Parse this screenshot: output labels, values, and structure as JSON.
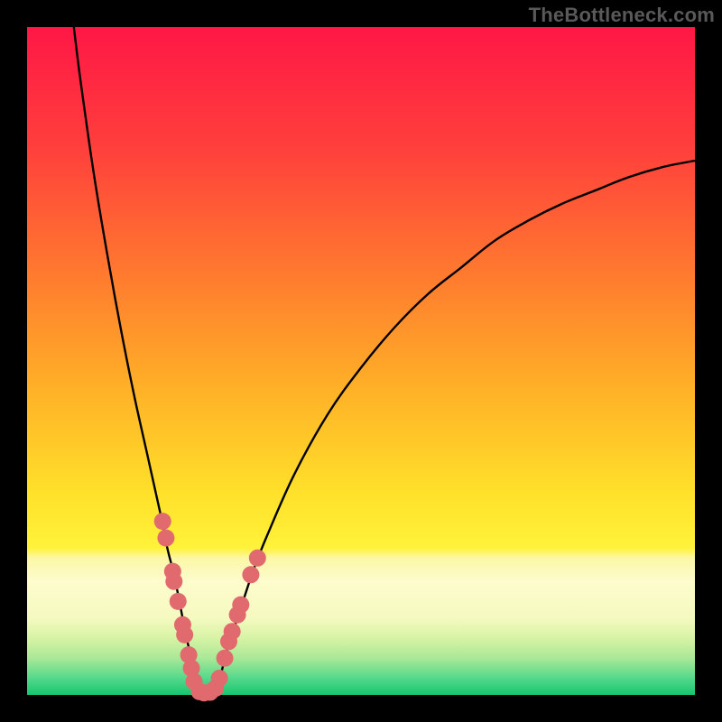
{
  "site": {
    "watermark": "TheBottleneck.com"
  },
  "chart_data": {
    "type": "line",
    "title": "",
    "xlabel": "",
    "ylabel": "",
    "xlim": [
      0,
      100
    ],
    "ylim": [
      0,
      100
    ],
    "series": [
      {
        "name": "left-curve",
        "x": [
          7,
          8,
          10,
          12,
          14,
          16,
          18,
          20,
          21,
          22,
          23,
          24,
          25,
          25.5,
          26
        ],
        "y": [
          100,
          92,
          78,
          66,
          55,
          45,
          36,
          27,
          22,
          18,
          13,
          8,
          4,
          1.5,
          0
        ]
      },
      {
        "name": "right-curve",
        "x": [
          28,
          29,
          30,
          32,
          34,
          36,
          40,
          45,
          50,
          55,
          60,
          65,
          70,
          75,
          80,
          85,
          90,
          95,
          100
        ],
        "y": [
          0,
          3,
          7,
          13,
          19,
          24,
          33,
          42,
          49,
          55,
          60,
          64,
          68,
          71,
          73.5,
          75.5,
          77.5,
          79,
          80
        ]
      }
    ],
    "markers": {
      "name": "scatter-points",
      "color": "#e16a6e",
      "points": [
        {
          "x": 20.3,
          "y": 26.0
        },
        {
          "x": 20.8,
          "y": 23.5
        },
        {
          "x": 21.8,
          "y": 18.5
        },
        {
          "x": 22.0,
          "y": 17.0
        },
        {
          "x": 22.6,
          "y": 14.0
        },
        {
          "x": 23.3,
          "y": 10.5
        },
        {
          "x": 23.6,
          "y": 9.0
        },
        {
          "x": 24.2,
          "y": 6.0
        },
        {
          "x": 24.6,
          "y": 4.0
        },
        {
          "x": 25.0,
          "y": 2.0
        },
        {
          "x": 25.8,
          "y": 0.5
        },
        {
          "x": 26.5,
          "y": 0.3
        },
        {
          "x": 27.4,
          "y": 0.4
        },
        {
          "x": 28.2,
          "y": 1.0
        },
        {
          "x": 28.8,
          "y": 2.5
        },
        {
          "x": 29.6,
          "y": 5.5
        },
        {
          "x": 30.2,
          "y": 8.0
        },
        {
          "x": 30.7,
          "y": 9.5
        },
        {
          "x": 31.5,
          "y": 12.0
        },
        {
          "x": 32.0,
          "y": 13.5
        },
        {
          "x": 33.5,
          "y": 18.0
        },
        {
          "x": 34.5,
          "y": 20.5
        }
      ]
    },
    "background": {
      "gradient_stops": [
        {
          "offset": 0.0,
          "color": "#ff1746"
        },
        {
          "offset": 0.18,
          "color": "#ff3f3c"
        },
        {
          "offset": 0.38,
          "color": "#ff7d2e"
        },
        {
          "offset": 0.55,
          "color": "#ffb327"
        },
        {
          "offset": 0.7,
          "color": "#ffe12a"
        },
        {
          "offset": 0.78,
          "color": "#fff23a"
        },
        {
          "offset": 0.795,
          "color": "#fbf7a6"
        },
        {
          "offset": 0.83,
          "color": "#fdfccd"
        },
        {
          "offset": 0.885,
          "color": "#f5fac0"
        },
        {
          "offset": 0.915,
          "color": "#d7f3a4"
        },
        {
          "offset": 0.945,
          "color": "#a9e897"
        },
        {
          "offset": 0.975,
          "color": "#55d88b"
        },
        {
          "offset": 1.0,
          "color": "#17c66f"
        }
      ]
    }
  }
}
